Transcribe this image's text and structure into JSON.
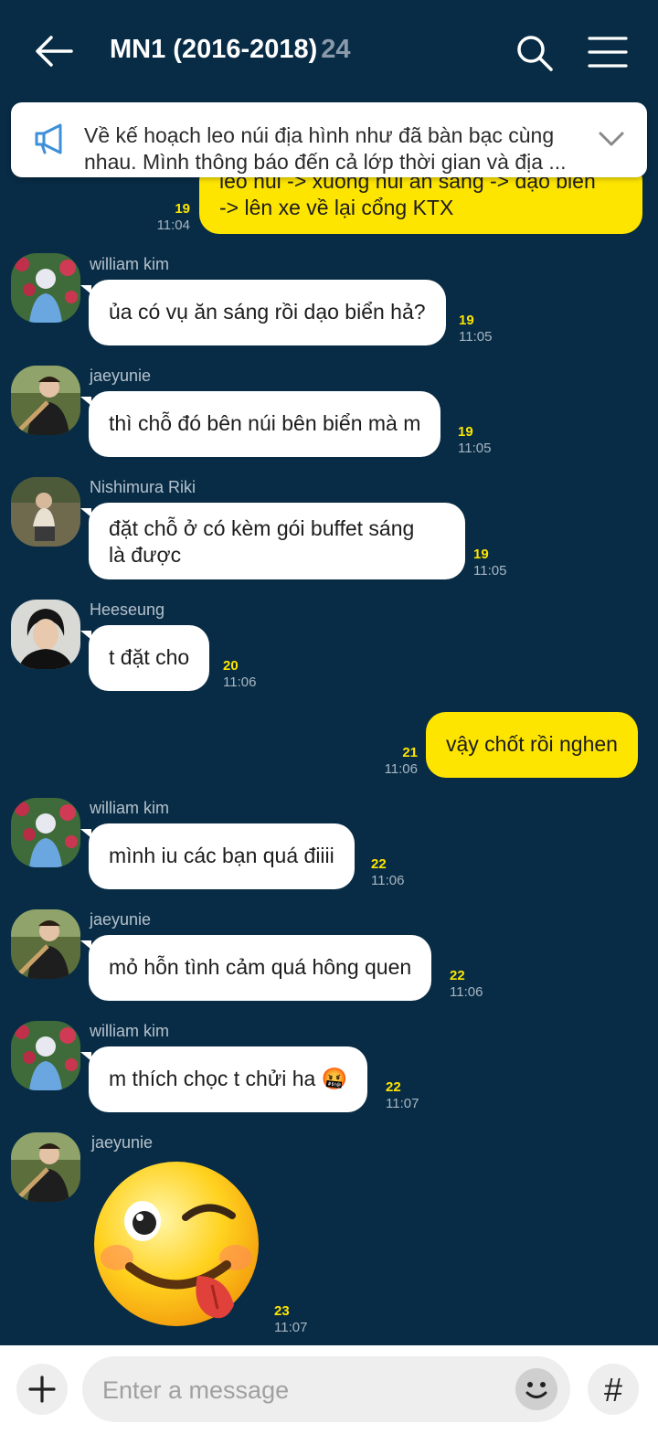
{
  "header": {
    "title": "MN1 (2016-2018)",
    "member_count": "24"
  },
  "notice": {
    "text": "Về kế hoạch leo núi địa hình như đã bàn bạc cùng nhau. Mình thông báo đến cả lớp thời gian và địa ..."
  },
  "messages": [
    {
      "mine": true,
      "text_line1": "leo núi -> xuống núi ăn sáng -> dạo biển",
      "text_line2": "-> lên xe về lại cổng KTX",
      "unread": "19",
      "time": "11:04"
    },
    {
      "sender": "william kim",
      "text": "ủa có vụ ăn sáng rồi dạo biển hả?",
      "unread": "19",
      "time": "11:05"
    },
    {
      "sender": "jaeyunie",
      "text": "thì chỗ đó bên núi bên biển mà m",
      "unread": "19",
      "time": "11:05"
    },
    {
      "sender": "Nishimura Riki",
      "text_line1": "đặt chỗ ở có kèm gói buffet sáng",
      "text_line2": "là được",
      "unread": "19",
      "time": "11:05"
    },
    {
      "sender": "Heeseung",
      "text": "t đặt cho",
      "unread": "20",
      "time": "11:06"
    },
    {
      "mine": true,
      "text": "vậy chốt rồi nghen",
      "unread": "21",
      "time": "11:06"
    },
    {
      "sender": "william kim",
      "text": "mình iu các bạn quá điiii",
      "unread": "22",
      "time": "11:06"
    },
    {
      "sender": "jaeyunie",
      "text": "mỏ hỗn tình cảm quá hông quen",
      "unread": "22",
      "time": "11:06"
    },
    {
      "sender": "william kim",
      "text": "m thích chọc t chửi ha",
      "emoji": "🤬",
      "unread": "22",
      "time": "11:07"
    },
    {
      "sender": "jaeyunie",
      "sticker": "winking-tongue-emoji",
      "unread": "23",
      "time": "11:07"
    }
  ],
  "input": {
    "placeholder": "Enter a message",
    "hash_label": "#"
  },
  "colors": {
    "background": "#082c45",
    "my_bubble": "#fee500",
    "other_bubble": "#ffffff",
    "unread": "#fee500"
  }
}
